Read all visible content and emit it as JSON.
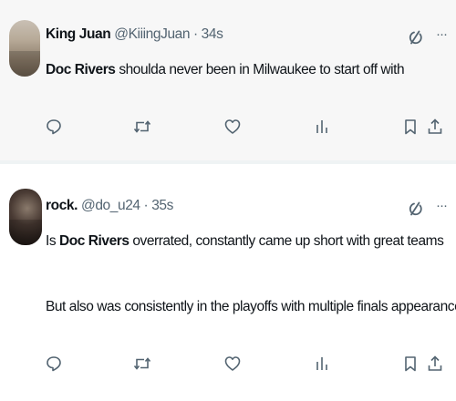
{
  "colors": {
    "text": "#0f1419",
    "secondary": "#536471",
    "post_bg_1": "#f7f7f7",
    "post_bg_2": "#ffffff"
  },
  "posts": [
    {
      "display_name": "King Juan",
      "handle_time": "@KiiingJuan · 34s",
      "lines": [
        {
          "bold": "Doc Rivers",
          "rest": " shoulda never been in Milwaukee to start off with"
        }
      ],
      "actions": [
        "reply-icon",
        "repost-icon",
        "like-icon",
        "views-icon",
        "bookmark-icon",
        "share-icon"
      ]
    },
    {
      "display_name": "rock.",
      "handle_time": "@do_u24 · 35s",
      "lines": [
        {
          "pre": "Is ",
          "bold": "Doc Rivers",
          "rest": " overrated, constantly came up short with great teams"
        },
        {
          "rest": "But also was consistently in the playoffs with multiple finals appearances"
        }
      ],
      "actions": [
        "reply-icon",
        "repost-icon",
        "like-icon",
        "views-icon",
        "bookmark-icon",
        "share-icon"
      ]
    }
  ],
  "more_glyph": "···"
}
